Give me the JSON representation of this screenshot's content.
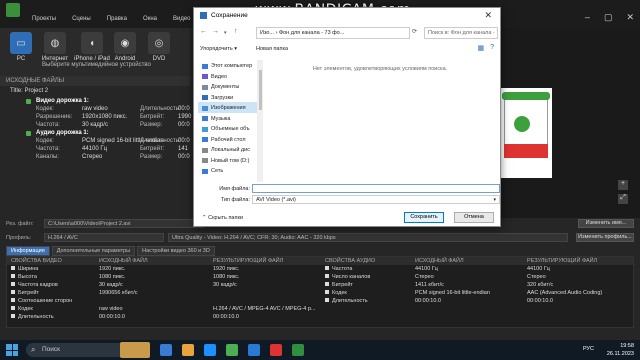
{
  "overlay": {
    "watermark": "www.BANDICAM.com"
  },
  "app": {
    "menu": [
      "Проекты",
      "Сцены",
      "Правка",
      "Окна",
      "Видео"
    ],
    "toolbar": {
      "items": [
        {
          "label": "PC",
          "icon": "monitor-icon"
        },
        {
          "label": "Интернет",
          "icon": "globe-icon"
        },
        {
          "label": "iPhone / iPad",
          "icon": "apple-icon"
        },
        {
          "label": "Android",
          "icon": "android-icon"
        },
        {
          "label": "DVD",
          "icon": "disc-icon"
        }
      ],
      "hint": "Выберите мультимедийное устройство"
    },
    "source": {
      "header": "ИСХОДНЫЕ ФАЙЛЫ",
      "project": "Title: Project 2",
      "video_title": "Видео дорожка 1:",
      "video": [
        {
          "k": "Кодек:",
          "v": "raw video"
        },
        {
          "k": "Разрешение:",
          "v": "1920x1080 пикс."
        },
        {
          "k": "Частота:",
          "v": "30 кадр/с"
        }
      ],
      "video_right": [
        {
          "k": "Длительность:",
          "v": "00:0"
        },
        {
          "k": "Битрейт:",
          "v": "1990"
        },
        {
          "k": "Размер:",
          "v": "00:0"
        }
      ],
      "audio_title": "Аудио дорожка 1:",
      "audio": [
        {
          "k": "Кодек:",
          "v": "PCM signed 16-bit little-endian"
        },
        {
          "k": "Частота:",
          "v": "44100 Гц"
        },
        {
          "k": "Каналы:",
          "v": "Стерео"
        }
      ],
      "audio_right": [
        {
          "k": "Длительность:",
          "v": "00:0"
        },
        {
          "k": "Битрейт:",
          "v": "141"
        },
        {
          "k": "Размер:",
          "v": "00:0"
        }
      ]
    },
    "output": {
      "file_label": "Рез. файл:",
      "file_value": "C:\\Users\\a000\\Video\\Project 2.avi",
      "change_name_btn": "Изменить имя...",
      "profile_label": "Профиль:",
      "profile_value": "H.264 / AVC",
      "profile_desc": "Ultra Quality - Video: H.264 / AVC; CFR: 30; Audio: AAC - 320 kbps",
      "change_profile_btn": "Изменить профиль..."
    },
    "tabs": [
      "Информация",
      "Дополнительные параметры",
      "Настройки видео 360 и 3D"
    ],
    "props": {
      "video_h": [
        "СВОЙСТВА ВИДЕО",
        "ИСХОДНЫЙ ФАЙЛ",
        "РЕЗУЛЬТИРУЮЩИЙ ФАЙЛ"
      ],
      "video_rows": [
        [
          "Ширина",
          "1920 пикс.",
          "1920 пикс."
        ],
        [
          "Высота",
          "1080 пикс.",
          "1080 пикс."
        ],
        [
          "Частота кадров",
          "30 кадр/с",
          "30 кадр/с"
        ],
        [
          "Битрейт",
          "1990656 кбит/с",
          ""
        ],
        [
          "Соотношение сторон",
          "",
          ""
        ],
        [
          "Кодек",
          "raw video",
          "H.264 / AVC / MPEG-4 AVC / MPEG-4 p..."
        ],
        [
          "Длительность",
          "00:00:10.0",
          "00:00:10.0"
        ]
      ],
      "audio_h": [
        "СВОЙСТВА АУДИО",
        "ИСХОДНЫЙ ФАЙЛ",
        "РЕЗУЛЬТИРУЮЩИЙ ФАЙЛ"
      ],
      "audio_rows": [
        [
          "Частота",
          "44100 Гц",
          "44100 Гц"
        ],
        [
          "Число каналов",
          "Стерео",
          "Стерео"
        ],
        [
          "Битрейт",
          "1411 кбит/с",
          "320 кбит/с"
        ],
        [
          "Кодек",
          "PCM signed 16-bit little-endian",
          "AAC (Advanced Audio Coding)"
        ],
        [
          "Длительность",
          "00:00:10.0",
          "00:00:10.0"
        ]
      ]
    }
  },
  "dialog": {
    "title": "Сохранение",
    "breadcrumb": "Изо... › Фон для канала - 73 фо...",
    "search_placeholder": "Поиск в: Фон для канала - 7...",
    "organize": "Упорядочить ▾",
    "new_folder": "Новая папка",
    "nav": [
      {
        "label": "Этот компьютер",
        "icon": "computer-icon",
        "color": "#3a7bd5"
      },
      {
        "label": "Видео",
        "icon": "video-folder-icon",
        "color": "#6a5acd"
      },
      {
        "label": "Документы",
        "icon": "documents-icon",
        "color": "#7a8ca0"
      },
      {
        "label": "Загрузки",
        "icon": "downloads-icon",
        "color": "#2f6db6"
      },
      {
        "label": "Изображения",
        "icon": "pictures-icon",
        "color": "#4a90d9"
      },
      {
        "label": "Музыка",
        "icon": "music-icon",
        "color": "#3a7bd5"
      },
      {
        "label": "Объемные объ",
        "icon": "3d-objects-icon",
        "color": "#3aa0d5"
      },
      {
        "label": "Рабочий стол",
        "icon": "desktop-icon",
        "color": "#3a7bd5"
      },
      {
        "label": "Локальный дис",
        "icon": "drive-icon",
        "color": "#888888"
      },
      {
        "label": "Новый том (D:)",
        "icon": "drive-icon",
        "color": "#888888"
      },
      {
        "label": "Сеть",
        "icon": "network-icon",
        "color": "#3a7bd5"
      }
    ],
    "empty_msg": "Нет элементов, удовлетворяющих условиям поиска.",
    "filename_label": "Имя файла:",
    "filename_value": "",
    "filetype_label": "Тип файла:",
    "filetype_value": "AVI Video (*.avi)",
    "hide_folders": "Скрыть папки",
    "save": "Сохранить",
    "cancel": "Отмена"
  },
  "taskbar": {
    "search": "Поиск",
    "lang": "РУС",
    "time": "19:58",
    "date": "26.11.2023"
  },
  "colors": {
    "accent": "#2f6db6",
    "dark_bg": "#262626"
  }
}
